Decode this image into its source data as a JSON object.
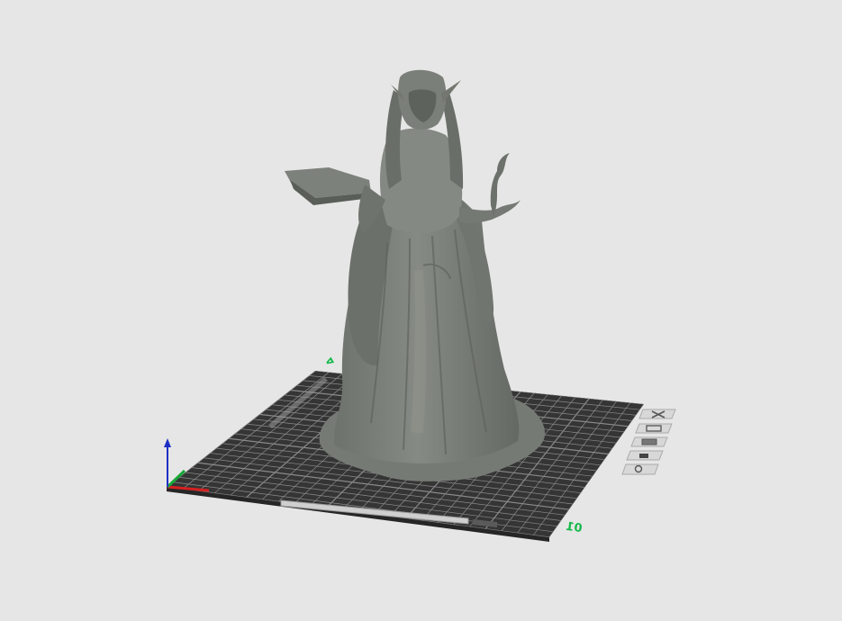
{
  "viewport": {
    "background": "#e6e6e6"
  },
  "build_plate": {
    "color": "#353535",
    "grid_color": "#8a8a8a",
    "label_text": "01",
    "corner_mark": "ᐊ",
    "accent_color": "#15b94a"
  },
  "model": {
    "name": "robed-figure-statue",
    "color": "#7f837d"
  },
  "axes": {
    "x_color": "#d42020",
    "y_color": "#18a838",
    "z_color": "#1c2fc4"
  },
  "plate_controls": [
    {
      "name": "remove-plate-icon",
      "glyph": "✕"
    },
    {
      "name": "arrange-plate-icon",
      "glyph": "⤢"
    },
    {
      "name": "orient-plate-icon",
      "glyph": "▤"
    },
    {
      "name": "lock-plate-icon",
      "glyph": "🔒"
    },
    {
      "name": "plate-settings-icon",
      "glyph": "⚙"
    }
  ]
}
